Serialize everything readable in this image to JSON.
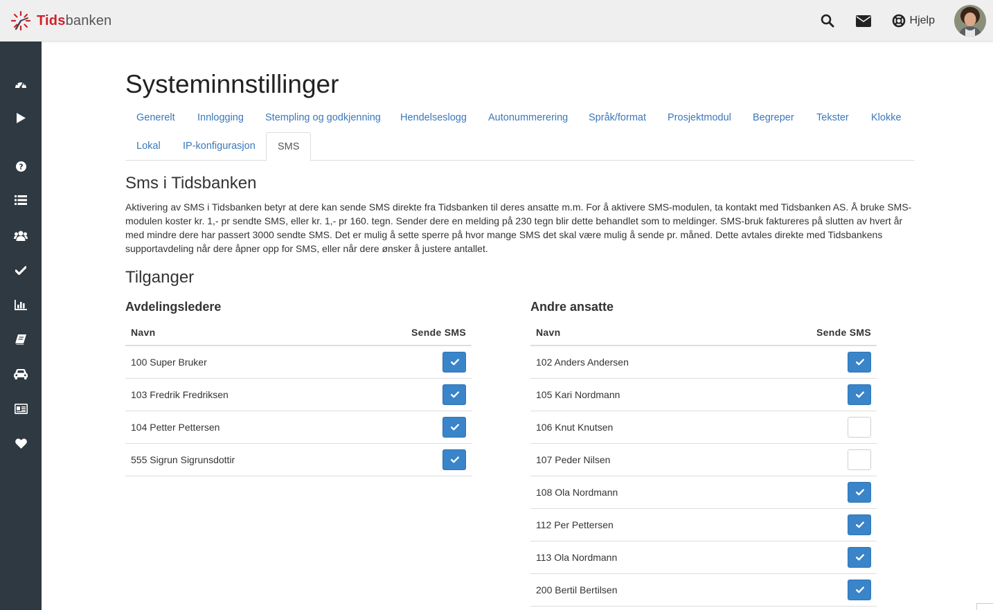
{
  "brand": {
    "name_part1": "Tids",
    "name_part2": "banken",
    "accent": "#d0202a"
  },
  "header": {
    "icons": [
      "search-icon",
      "envelope-icon",
      "life-ring-icon"
    ],
    "help_label": "Hjelp"
  },
  "sidebar": {
    "items": [
      {
        "icon": "dashboard-icon"
      },
      {
        "icon": "play-icon"
      },
      {
        "icon": "question-circle-icon"
      },
      {
        "icon": "list-icon"
      },
      {
        "icon": "users-icon"
      },
      {
        "icon": "check-icon"
      },
      {
        "icon": "bar-chart-icon"
      },
      {
        "icon": "book-icon"
      },
      {
        "icon": "car-icon"
      },
      {
        "icon": "id-card-icon"
      },
      {
        "icon": "heart-icon"
      }
    ],
    "background": "#2f3941"
  },
  "page": {
    "title": "Systeminnstillinger",
    "tabs": [
      {
        "label": "Generelt"
      },
      {
        "label": "Innlogging"
      },
      {
        "label": "Stempling og godkjenning"
      },
      {
        "label": "Hendelseslogg"
      },
      {
        "label": "Autonummerering"
      },
      {
        "label": "Språk/format"
      },
      {
        "label": "Prosjektmodul"
      },
      {
        "label": "Begreper"
      },
      {
        "label": "Tekster"
      },
      {
        "label": "Klokke"
      },
      {
        "label": "Lokal"
      },
      {
        "label": "IP-konfigurasjon"
      },
      {
        "label": "SMS"
      }
    ],
    "active_tab": "SMS"
  },
  "sms": {
    "title": "Sms i Tidsbanken",
    "description": "Aktivering av SMS i Tidsbanken betyr at dere kan sende SMS direkte fra Tidsbanken til deres ansatte m.m. For å aktivere SMS-modulen, ta kontakt med Tidsbanken AS. Å bruke SMS-modulen koster kr. 1,- pr sendte SMS, eller kr. 1,- pr 160. tegn. Sender dere en melding på 230 tegn blir dette behandlet som to meldinger. SMS-bruk faktureres på slutten av hvert år med mindre dere har passert 3000 sendte SMS. Det er mulig å sette sperre på hvor mange SMS det skal være mulig å sende pr. måned. Dette avtales direkte med Tidsbankens supportavdeling når dere åpner opp for SMS, eller når dere ønsker å justere antallet."
  },
  "access": {
    "title": "Tilganger",
    "leaders": {
      "title": "Avdelingsledere",
      "col_name": "Navn",
      "col_send": "Sende SMS",
      "rows": [
        {
          "name": "100 Super Bruker",
          "checked": true
        },
        {
          "name": "103 Fredrik Fredriksen",
          "checked": true
        },
        {
          "name": "104 Petter Pettersen",
          "checked": true
        },
        {
          "name": "555 Sigrun Sigrunsdottir",
          "checked": true
        }
      ]
    },
    "others": {
      "title": "Andre ansatte",
      "col_name": "Navn",
      "col_send": "Sende SMS",
      "rows": [
        {
          "name": "102 Anders Andersen",
          "checked": true
        },
        {
          "name": "105 Kari Nordmann",
          "checked": true
        },
        {
          "name": "106 Knut Knutsen",
          "checked": false
        },
        {
          "name": "107 Peder Nilsen",
          "checked": false
        },
        {
          "name": "108 Ola Nordmann",
          "checked": true
        },
        {
          "name": "112 Per Pettersen",
          "checked": true
        },
        {
          "name": "113 Ola Nordmann",
          "checked": true
        },
        {
          "name": "200 Bertil Bertilsen",
          "checked": true
        }
      ]
    }
  },
  "colors": {
    "link": "#3a78b9",
    "checkbox_on": "#3a84c9",
    "topbar": "#efefef"
  }
}
